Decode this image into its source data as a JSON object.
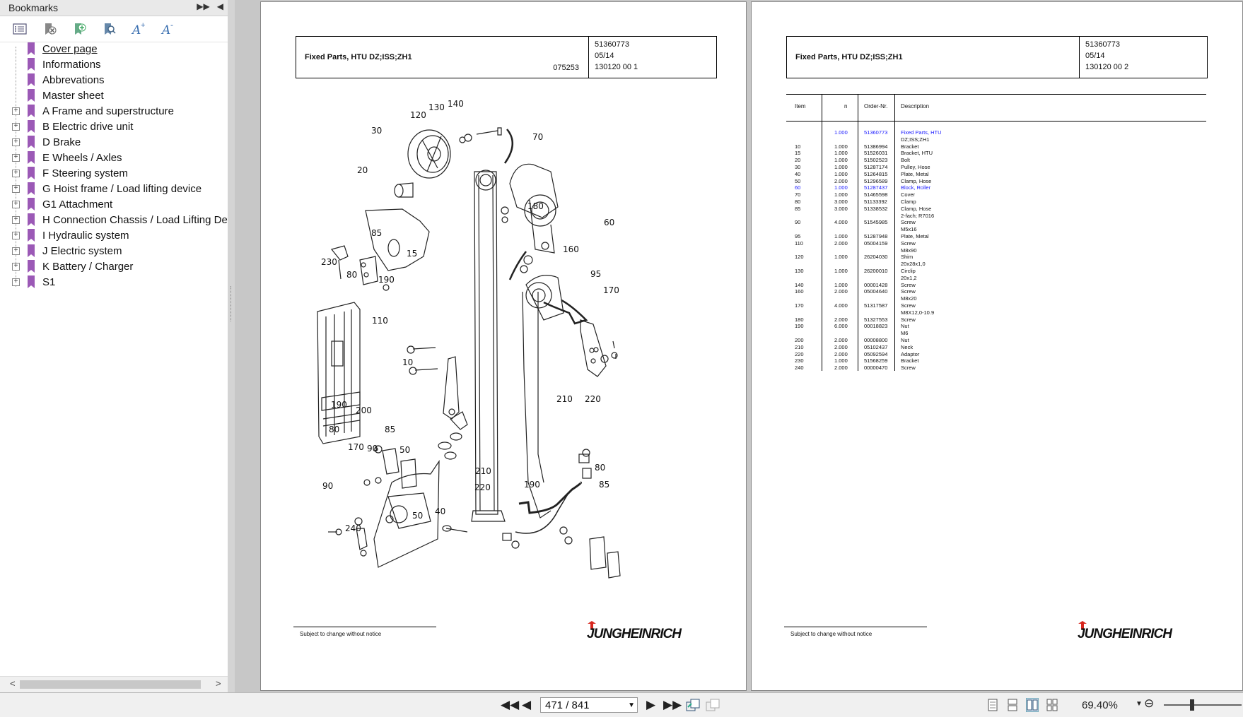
{
  "sidebar": {
    "title": "Bookmarks",
    "items": [
      {
        "label": "Cover page",
        "expandable": false
      },
      {
        "label": "Informations",
        "expandable": false
      },
      {
        "label": "Abbrevations",
        "expandable": false
      },
      {
        "label": "Master sheet",
        "expandable": false
      },
      {
        "label": "A Frame and superstructure",
        "expandable": true
      },
      {
        "label": "B Electric drive unit",
        "expandable": true
      },
      {
        "label": "D Brake",
        "expandable": true
      },
      {
        "label": "E Wheels / Axles",
        "expandable": true
      },
      {
        "label": "F Steering system",
        "expandable": true
      },
      {
        "label": "G Hoist frame / Load lifting device",
        "expandable": true
      },
      {
        "label": "G1 Attachment",
        "expandable": true
      },
      {
        "label": "H Connection Chassis / Load Lifting Devi",
        "expandable": true
      },
      {
        "label": "I Hydraulic system",
        "expandable": true
      },
      {
        "label": "J Electric system",
        "expandable": true
      },
      {
        "label": "K Battery / Charger",
        "expandable": true
      },
      {
        "label": "S1",
        "expandable": true
      }
    ]
  },
  "page1": {
    "title": "Fixed Parts, HTU DZ;ISS;ZH1",
    "code": "075253",
    "number": "51360773",
    "date": "05/14",
    "ref": "130120 00 1",
    "footnote": "Subject to change without notice",
    "logo": "JUNGHEINRICH",
    "callouts": [
      "130",
      "140",
      "120",
      "30",
      "20",
      "70",
      "180",
      "60",
      "160",
      "85",
      "15",
      "230",
      "80",
      "190",
      "95",
      "170",
      "110",
      "10",
      "210",
      "220",
      "190",
      "200",
      "80",
      "85",
      "170",
      "90",
      "50",
      "90",
      "240",
      "40",
      "50",
      "210",
      "220",
      "190",
      "80",
      "85"
    ]
  },
  "page2": {
    "title": "Fixed Parts, HTU DZ;ISS;ZH1",
    "number": "51360773",
    "date": "05/14",
    "ref": "130120 00 2",
    "footnote": "Subject to change without notice",
    "logo": "JUNGHEINRICH",
    "table": {
      "headers": {
        "item": "Item",
        "n": "n",
        "order": "Order-Nr.",
        "desc": "Description"
      },
      "rows": [
        {
          "item": "",
          "n": "1.000",
          "order": "51360773",
          "desc": "Fixed Parts, HTU",
          "link": true
        },
        {
          "item": "",
          "n": "",
          "order": "",
          "desc": "DZ;ISS;ZH1"
        },
        {
          "item": "10",
          "n": "1.000",
          "order": "51386994",
          "desc": "Bracket"
        },
        {
          "item": "15",
          "n": "1.000",
          "order": "51526031",
          "desc": "Bracket, HTU"
        },
        {
          "item": "20",
          "n": "1.000",
          "order": "51502523",
          "desc": "Bolt"
        },
        {
          "item": "30",
          "n": "1.000",
          "order": "51287174",
          "desc": "Pulley, Hose"
        },
        {
          "item": "40",
          "n": "1.000",
          "order": "51264815",
          "desc": "Plate, Metal"
        },
        {
          "item": "50",
          "n": "2.000",
          "order": "51296589",
          "desc": "Clamp, Hose"
        },
        {
          "item": "60",
          "n": "1.000",
          "order": "51287437",
          "desc": "Block, Roller",
          "link": true
        },
        {
          "item": "70",
          "n": "1.000",
          "order": "51465598",
          "desc": "Cover"
        },
        {
          "item": "80",
          "n": "3.000",
          "order": "51133392",
          "desc": "Clamp"
        },
        {
          "item": "85",
          "n": "3.000",
          "order": "51338532",
          "desc": "Clamp, Hose"
        },
        {
          "item": "",
          "n": "",
          "order": "",
          "desc": "2-fach; R7016"
        },
        {
          "item": "90",
          "n": "4.000",
          "order": "51545985",
          "desc": "Screw"
        },
        {
          "item": "",
          "n": "",
          "order": "",
          "desc": "M5x16"
        },
        {
          "item": "95",
          "n": "1.000",
          "order": "51287948",
          "desc": "Plate, Metal"
        },
        {
          "item": "110",
          "n": "2.000",
          "order": "05004159",
          "desc": "Screw"
        },
        {
          "item": "",
          "n": "",
          "order": "",
          "desc": "M8x90"
        },
        {
          "item": "120",
          "n": "1.000",
          "order": "26204030",
          "desc": "Shim"
        },
        {
          "item": "",
          "n": "",
          "order": "",
          "desc": "20x28x1,0"
        },
        {
          "item": "130",
          "n": "1.000",
          "order": "26200010",
          "desc": "Circlip"
        },
        {
          "item": "",
          "n": "",
          "order": "",
          "desc": "20x1,2"
        },
        {
          "item": "140",
          "n": "1.000",
          "order": "00001428",
          "desc": "Screw"
        },
        {
          "item": "160",
          "n": "2.000",
          "order": "05004640",
          "desc": "Screw"
        },
        {
          "item": "",
          "n": "",
          "order": "",
          "desc": "M8x20"
        },
        {
          "item": "170",
          "n": "4.000",
          "order": "51317587",
          "desc": "Screw"
        },
        {
          "item": "",
          "n": "",
          "order": "",
          "desc": "M8X12,0-10.9"
        },
        {
          "item": "180",
          "n": "2.000",
          "order": "51327553",
          "desc": "Screw"
        },
        {
          "item": "190",
          "n": "6.000",
          "order": "00018823",
          "desc": "Nut"
        },
        {
          "item": "",
          "n": "",
          "order": "",
          "desc": "M6"
        },
        {
          "item": "200",
          "n": "2.000",
          "order": "00008800",
          "desc": "Nut"
        },
        {
          "item": "210",
          "n": "2.000",
          "order": "05102437",
          "desc": "Neck"
        },
        {
          "item": "220",
          "n": "2.000",
          "order": "05092594",
          "desc": "Adaptor"
        },
        {
          "item": "230",
          "n": "1.000",
          "order": "51568259",
          "desc": "Bracket"
        },
        {
          "item": "240",
          "n": "2.000",
          "order": "00000470",
          "desc": "Screw"
        }
      ]
    }
  },
  "bottombar": {
    "page_display": "471 / 841",
    "zoom": "69.40%"
  },
  "colors": {
    "link": "#1a1aff",
    "bookmark": "#9b59b6",
    "logo_red": "#d7261e"
  }
}
